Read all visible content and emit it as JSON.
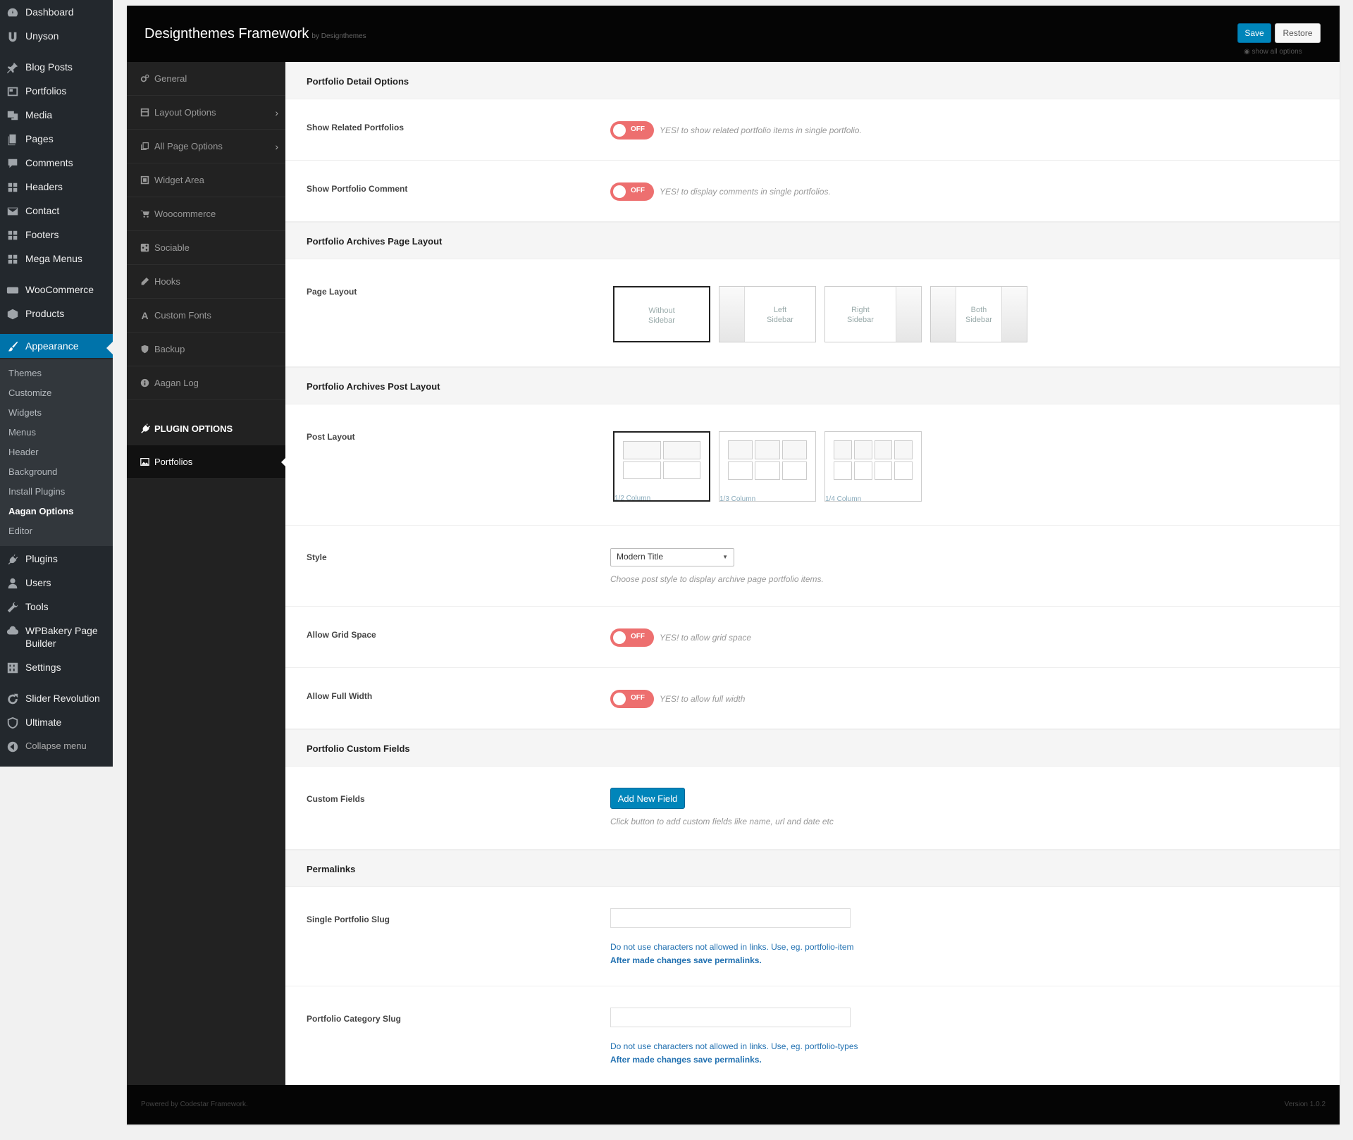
{
  "admin_menu": {
    "items": [
      {
        "label": "Dashboard",
        "icon": "dashboard-icon"
      },
      {
        "label": "Unyson",
        "icon": "unyson-icon"
      },
      {
        "label": "Blog Posts",
        "icon": "pin-icon"
      },
      {
        "label": "Portfolios",
        "icon": "portfolio-icon"
      },
      {
        "label": "Media",
        "icon": "media-icon"
      },
      {
        "label": "Pages",
        "icon": "pages-icon"
      },
      {
        "label": "Comments",
        "icon": "comment-icon"
      },
      {
        "label": "Headers",
        "icon": "grid-icon"
      },
      {
        "label": "Contact",
        "icon": "mail-icon"
      },
      {
        "label": "Footers",
        "icon": "grid-icon"
      },
      {
        "label": "Mega Menus",
        "icon": "grid-icon"
      },
      {
        "label": "WooCommerce",
        "icon": "woo-icon"
      },
      {
        "label": "Products",
        "icon": "box-icon"
      },
      {
        "label": "Appearance",
        "icon": "brush-icon"
      },
      {
        "label": "Plugins",
        "icon": "plug-icon"
      },
      {
        "label": "Users",
        "icon": "user-icon"
      },
      {
        "label": "Tools",
        "icon": "wrench-icon"
      },
      {
        "label": "WPBakery Page Builder",
        "icon": "cloud-icon"
      },
      {
        "label": "Settings",
        "icon": "settings-icon"
      },
      {
        "label": "Slider Revolution",
        "icon": "refresh-icon"
      },
      {
        "label": "Ultimate",
        "icon": "shield-icon"
      },
      {
        "label": "Collapse menu",
        "icon": "collapse-icon"
      }
    ],
    "appearance_submenu": [
      "Themes",
      "Customize",
      "Widgets",
      "Menus",
      "Header",
      "Background",
      "Install Plugins",
      "Aagan Options",
      "Editor"
    ]
  },
  "header": {
    "title": "Designthemes Framework",
    "by": "by Designthemes",
    "save_label": "Save",
    "restore_label": "Restore",
    "show_all": "show all options"
  },
  "nav": {
    "items": [
      {
        "label": "General",
        "icon": "cogs-icon"
      },
      {
        "label": "Layout Options",
        "icon": "layout-icon"
      },
      {
        "label": "All Page Options",
        "icon": "copy-icon"
      },
      {
        "label": "Widget Area",
        "icon": "widget-icon"
      },
      {
        "label": "Woocommerce",
        "icon": "cart-icon"
      },
      {
        "label": "Sociable",
        "icon": "share-icon"
      },
      {
        "label": "Hooks",
        "icon": "pen-icon"
      },
      {
        "label": "Custom Fonts",
        "icon": "font-icon"
      },
      {
        "label": "Backup",
        "icon": "shield-icon"
      },
      {
        "label": "Aagan Log",
        "icon": "info-icon"
      }
    ],
    "group_label": "PLUGIN OPTIONS",
    "active_item": "Portfolios"
  },
  "content": {
    "sections": {
      "detail": "Portfolio Detail Options",
      "archives_page": "Portfolio Archives Page Layout",
      "archives_post": "Portfolio Archives Post Layout",
      "custom_fields": "Portfolio Custom Fields",
      "permalinks": "Permalinks"
    },
    "show_related": {
      "label": "Show Related Portfolios",
      "state": "OFF",
      "hint": "YES! to show related portfolio items in single portfolio."
    },
    "show_comment": {
      "label": "Show Portfolio Comment",
      "state": "OFF",
      "hint": "YES! to display comments in single portfolios."
    },
    "page_layout": {
      "label": "Page Layout",
      "options": [
        "Without Sidebar",
        "Left Sidebar",
        "Right Sidebar",
        "Both Sidebar"
      ],
      "selected": "Without Sidebar"
    },
    "post_layout": {
      "label": "Post Layout",
      "options": [
        "1/2 Column",
        "1/3 Column",
        "1/4 Column"
      ],
      "selected": "1/2 Column"
    },
    "style": {
      "label": "Style",
      "value": "Modern Title",
      "hint": "Choose post style to display archive page portfolio items."
    },
    "grid_space": {
      "label": "Allow Grid Space",
      "state": "OFF",
      "hint": "YES! to allow grid space"
    },
    "full_width": {
      "label": "Allow Full Width",
      "state": "OFF",
      "hint": "YES! to allow full width"
    },
    "custom_fields": {
      "label": "Custom Fields",
      "button": "Add New Field",
      "hint": "Click button to add custom fields like name, url and date etc"
    },
    "single_slug": {
      "label": "Single Portfolio Slug",
      "value": "",
      "note1": "Do not use characters not allowed in links. Use, eg. portfolio-item",
      "note2": "After made changes save permalinks."
    },
    "category_slug": {
      "label": "Portfolio Category Slug",
      "value": "",
      "note1": "Do not use characters not allowed in links. Use, eg. portfolio-types",
      "note2": "After made changes save permalinks."
    }
  },
  "footer": {
    "left": "Powered by Codestar Framework.",
    "right": "Version 1.0.2"
  },
  "colors": {
    "accent": "#0073aa",
    "toggle_off": "#ed6f6f",
    "button": "#0085ba"
  }
}
